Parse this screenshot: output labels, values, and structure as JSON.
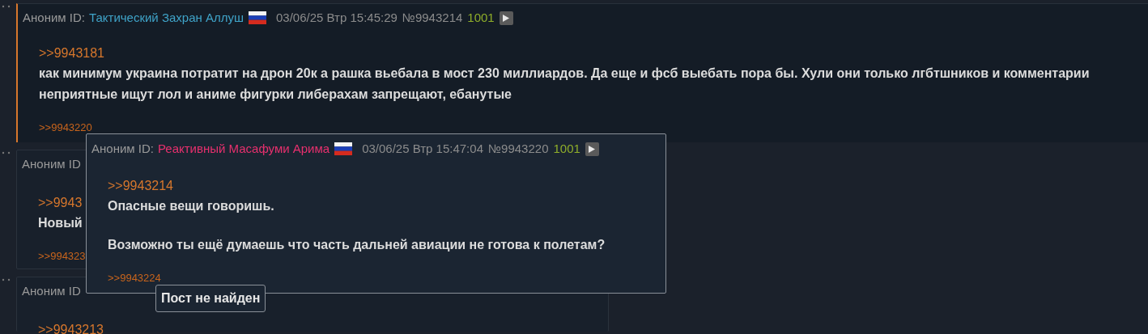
{
  "post": {
    "author": "Аноним ID:",
    "name": "Тактический Захран Аллуш",
    "color": "#3fa3c8",
    "date": "03/06/25 Втр 15:45:29",
    "number": "№9943214",
    "count": "1001",
    "quote": ">>9943181",
    "body": [
      "как минимум украина потратит на дрон 20к а рашка вьебала в мост 230 миллиардов. Да еще и фсб выебать пора бы. Хули они только лгбтшников и комментарии неприятные ищут лол и аниме фигурки либерахам запрещают, ебанутые"
    ],
    "replies": [
      ">>9943220"
    ]
  },
  "covered_posts": [
    {
      "header": "Аноним ID",
      "quote": ">>9943",
      "body": "Новый",
      "reply": ">>994323"
    },
    {
      "header": "Аноним ID",
      "quote": ">>9943213"
    }
  ],
  "popup": {
    "author": "Аноним ID:",
    "name": "Реактивный Масафуми Арима",
    "color": "#e8306e",
    "date": "03/06/25 Втр 15:47:04",
    "number": "№9943220",
    "count": "1001",
    "quote": ">>9943214",
    "body": [
      "Опасные вещи говоришь.",
      "Возможно ты ещё думаешь что часть дальней авиации не готова к полетам?"
    ],
    "replies": [
      ">>9943224"
    ]
  },
  "tooltip": {
    "text": "Пост не найден"
  }
}
